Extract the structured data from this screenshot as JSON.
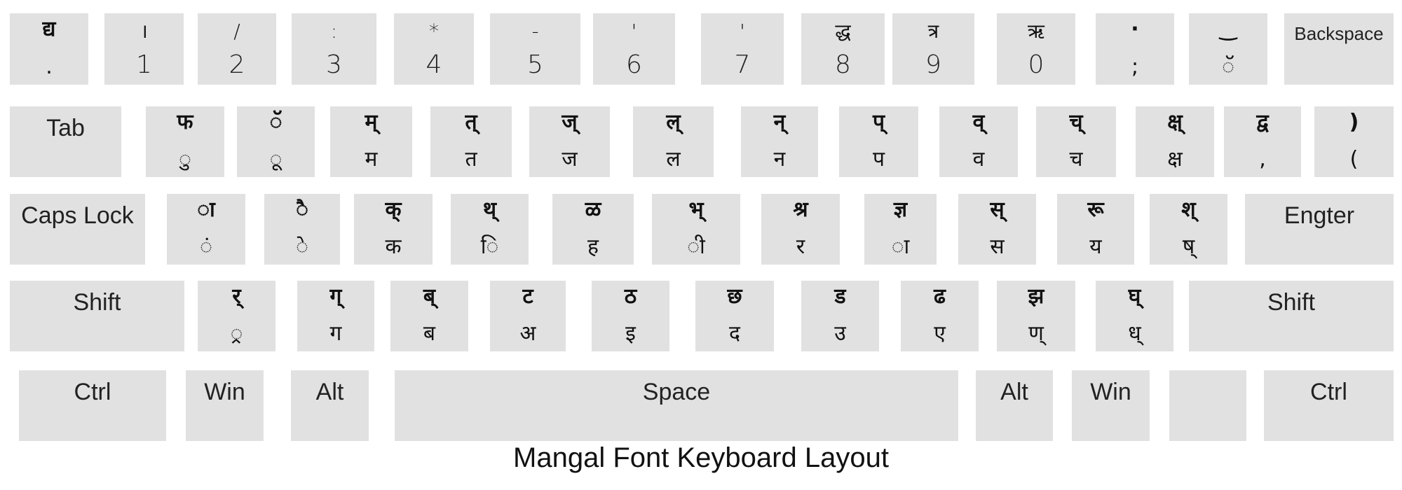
{
  "title": "Mangal Font Keyboard Layout",
  "key_color": "#e1e1e1",
  "rows": [
    {
      "name": "number-row",
      "keys": [
        {
          "top": "द्य",
          "bottom": "."
        },
        {
          "top": "।",
          "bottom": "1"
        },
        {
          "top": "/",
          "bottom": "2"
        },
        {
          "top": ":",
          "bottom": "3"
        },
        {
          "top": "*",
          "bottom": "4"
        },
        {
          "top": "-",
          "bottom": "5"
        },
        {
          "top": "'",
          "bottom": "6"
        },
        {
          "top": "'",
          "bottom": "7"
        },
        {
          "top": "द्ध",
          "bottom": "8"
        },
        {
          "top": "त्र",
          "bottom": "9"
        },
        {
          "top": "ऋ",
          "bottom": "0"
        },
        {
          "top": "·",
          "bottom": ";"
        },
        {
          "top": "‿",
          "bottom": "ॅ"
        },
        {
          "label": "Backspace"
        }
      ]
    },
    {
      "name": "qwerty-row",
      "keys": [
        {
          "label": "Tab"
        },
        {
          "top": "फ",
          "bottom": "ु"
        },
        {
          "top": "ॅ",
          "bottom": "ू"
        },
        {
          "top": "म्",
          "bottom": "म"
        },
        {
          "top": "त्",
          "bottom": "त"
        },
        {
          "top": "ज्",
          "bottom": "ज"
        },
        {
          "top": "ल्",
          "bottom": "ल"
        },
        {
          "top": "न्",
          "bottom": "न"
        },
        {
          "top": "प्",
          "bottom": "प"
        },
        {
          "top": "व्",
          "bottom": "व"
        },
        {
          "top": "च्",
          "bottom": "च"
        },
        {
          "top": "क्ष्",
          "bottom": "क्ष"
        },
        {
          "top": "द्व",
          "bottom": ","
        },
        {
          "top": ")",
          "bottom": "("
        }
      ]
    },
    {
      "name": "home-row",
      "keys": [
        {
          "label": "Caps Lock"
        },
        {
          "top": "ा",
          "bottom": "ं"
        },
        {
          "top": "ै",
          "bottom": "े"
        },
        {
          "top": "क्",
          "bottom": "क"
        },
        {
          "top": "थ्",
          "bottom": "ि"
        },
        {
          "top": "ळ",
          "bottom": "ह"
        },
        {
          "top": "भ्",
          "bottom": "ी"
        },
        {
          "top": "श्र",
          "bottom": "र"
        },
        {
          "top": "ज्ञ",
          "bottom": "ा"
        },
        {
          "top": "स्",
          "bottom": "स"
        },
        {
          "top": "रू",
          "bottom": "य"
        },
        {
          "top": "श्",
          "bottom": "ष्"
        },
        {
          "label": "Engter"
        }
      ]
    },
    {
      "name": "shift-row",
      "keys": [
        {
          "label": "Shift"
        },
        {
          "top": "र्",
          "bottom": "्र"
        },
        {
          "top": "ग्",
          "bottom": "ग"
        },
        {
          "top": "ब्",
          "bottom": "ब"
        },
        {
          "top": "ट",
          "bottom": "अ"
        },
        {
          "top": "ठ",
          "bottom": "इ"
        },
        {
          "top": "छ",
          "bottom": "द"
        },
        {
          "top": "ड",
          "bottom": "उ"
        },
        {
          "top": "ढ",
          "bottom": "ए"
        },
        {
          "top": "झ",
          "bottom": "ण्"
        },
        {
          "top": "घ्",
          "bottom": "ध्"
        },
        {
          "label": "Shift"
        }
      ]
    },
    {
      "name": "bottom-row",
      "keys": [
        {
          "label": "Ctrl"
        },
        {
          "label": "Win"
        },
        {
          "label": "Alt"
        },
        {
          "label": "Space"
        },
        {
          "label": "Alt"
        },
        {
          "label": "Win"
        },
        {
          "label": ""
        },
        {
          "label": "Ctrl"
        }
      ]
    }
  ]
}
